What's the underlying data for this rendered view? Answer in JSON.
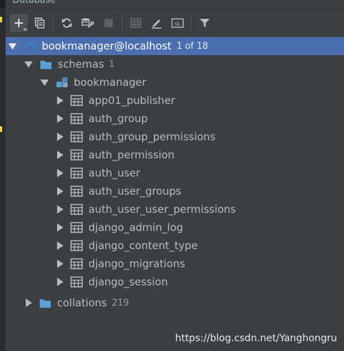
{
  "panel": {
    "title": "Database"
  },
  "toolbar": {
    "buttons": [
      "add-icon",
      "duplicate-icon",
      "refresh-icon",
      "sync-settings-icon",
      "stop-icon",
      "table-editor-icon",
      "edit-icon",
      "console-icon",
      "filter-icon"
    ]
  },
  "tree": {
    "datasource": {
      "label": "bookmanager@localhost",
      "count": "1 of 18"
    },
    "schemas": {
      "label": "schemas",
      "count": "1"
    },
    "schema": {
      "label": "bookmanager"
    },
    "tables": [
      {
        "label": "app01_publisher"
      },
      {
        "label": "auth_group"
      },
      {
        "label": "auth_group_permissions"
      },
      {
        "label": "auth_permission"
      },
      {
        "label": "auth_user"
      },
      {
        "label": "auth_user_groups"
      },
      {
        "label": "auth_user_user_permissions"
      },
      {
        "label": "django_admin_log"
      },
      {
        "label": "django_content_type"
      },
      {
        "label": "django_migrations"
      },
      {
        "label": "django_session"
      }
    ],
    "collations": {
      "label": "collations",
      "count": "219"
    }
  },
  "watermark": "https://blog.csdn.net/Yanghongru",
  "colors": {
    "selection": "#4b6eaf",
    "panel": "#3c3f41",
    "folder": "#5a9fd4"
  }
}
